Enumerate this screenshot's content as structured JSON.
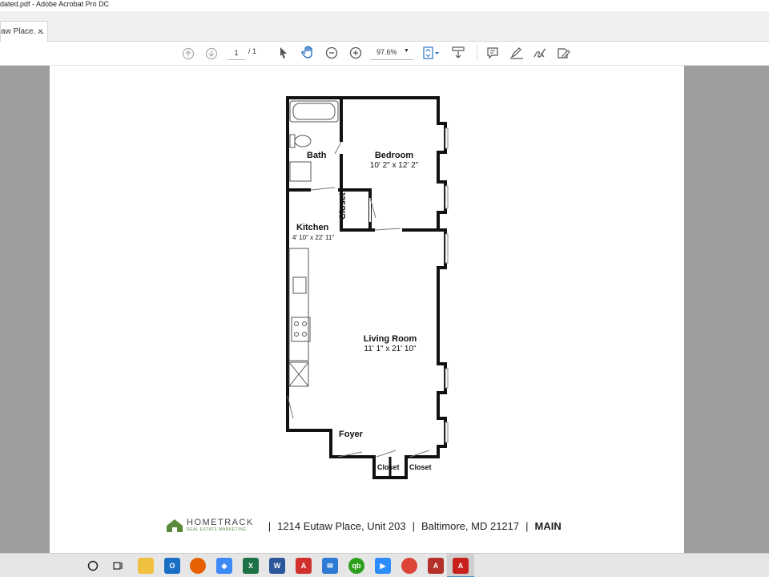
{
  "window": {
    "title": "dated.pdf - Adobe Acrobat Pro DC"
  },
  "tab": {
    "label": "aw Place. ...",
    "close": "×"
  },
  "toolbar": {
    "page_current": "1",
    "page_total": "/ 1",
    "zoom": "97.6%",
    "icons": [
      "page-up-icon",
      "page-down-icon",
      "select-arrow-icon",
      "hand-tool-icon",
      "zoom-out-icon",
      "zoom-in-icon",
      "page-fit-icon",
      "scroll-mode-icon",
      "comment-icon",
      "highlight-pen-icon",
      "sign-icon",
      "fill-sign-icon"
    ]
  },
  "floorplan": {
    "rooms": {
      "bath": "Bath",
      "bedroom": "Bedroom",
      "bedroom_dim": "10' 2\" x 12' 2\"",
      "closet_vertical": "Closet",
      "kitchen": "Kitchen",
      "kitchen_dim": "4' 10\" x 22' 11\"",
      "living": "Living Room",
      "living_dim": "11' 1\" x 21' 10\"",
      "foyer": "Foyer",
      "closet_a": "Closet",
      "closet_b": "Closet"
    }
  },
  "footer": {
    "logo_name": "HOMETRACK",
    "logo_sub": "REAL ESTATE MARKETING",
    "sep": "|",
    "address": "1214 Eutaw Place, Unit 203",
    "city": "Baltimore, MD 21217",
    "floor": "MAIN"
  },
  "colors": {
    "viewer_bg": "#9e9e9e",
    "logo_green": "#5a8a3a",
    "acrobat_red": "#d0312d"
  },
  "taskbar": {
    "icons": [
      "start-icon",
      "task-view-icon",
      "file-explorer-icon",
      "outlook-icon",
      "firefox-icon",
      "dropbox-icon",
      "excel-icon",
      "word-icon",
      "acrobat-reader-icon",
      "windows-mail-icon",
      "quickbooks-icon",
      "zoom-icon",
      "chrome-icon",
      "acrobat-pro-icon-2",
      "acrobat-pro-icon"
    ]
  }
}
